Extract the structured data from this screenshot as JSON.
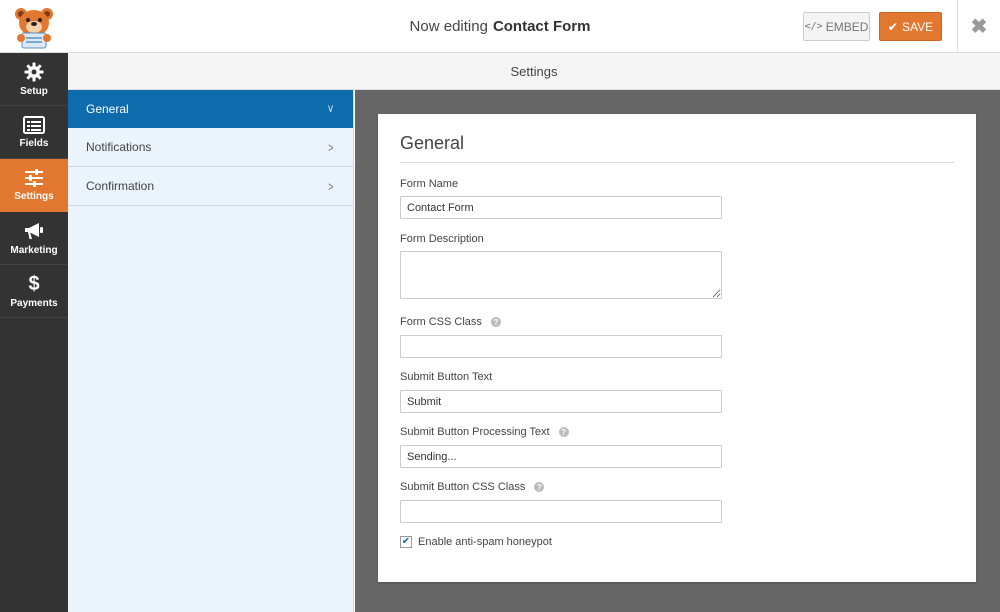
{
  "header": {
    "title_prefix": "Now editing",
    "form_name": "Contact Form",
    "embed_label": "EMBED",
    "save_label": "SAVE",
    "close_symbol": "✖"
  },
  "leftnav": {
    "items": [
      {
        "label": "Setup",
        "icon": "gear-icon"
      },
      {
        "label": "Fields",
        "icon": "list-icon"
      },
      {
        "label": "Settings",
        "icon": "sliders-icon",
        "active": true
      },
      {
        "label": "Marketing",
        "icon": "megaphone-icon"
      },
      {
        "label": "Payments",
        "icon": "dollar-icon"
      }
    ]
  },
  "subheader": {
    "title": "Settings"
  },
  "sidebar": {
    "items": [
      {
        "label": "General",
        "active": true
      },
      {
        "label": "Notifications"
      },
      {
        "label": "Confirmation"
      }
    ]
  },
  "general": {
    "title": "General",
    "form_name_label": "Form Name",
    "form_name_value": "Contact Form",
    "form_description_label": "Form Description",
    "form_description_value": "",
    "css_class_label": "Form CSS Class",
    "css_class_value": "",
    "submit_text_label": "Submit Button Text",
    "submit_text_value": "Submit",
    "processing_text_label": "Submit Button Processing Text",
    "processing_text_value": "Sending...",
    "submit_css_label": "Submit Button CSS Class",
    "submit_css_value": "",
    "honeypot_label": "Enable anti-spam honeypot",
    "honeypot_checked": true
  },
  "colors": {
    "accent": "#e27730",
    "active_panel": "#0e6cad",
    "nav_bg": "#333333",
    "sidebar_bg": "#ebf3fb",
    "content_bg": "#666666"
  }
}
